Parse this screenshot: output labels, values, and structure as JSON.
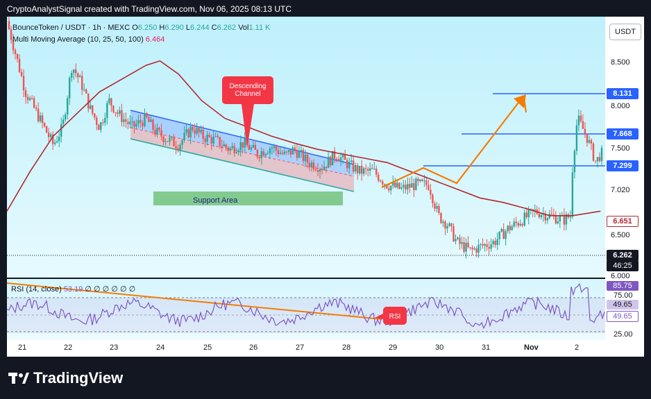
{
  "caption": "CryptoAnalystSignal created with TradingView.com, Nov 06, 2025 08:13 UTC",
  "legend": {
    "symbol": "BounceToken / USDT · 1h · MEXC",
    "open_label": "O",
    "open": "6.250",
    "high_label": "H",
    "high": "6.290",
    "low_label": "L",
    "low": "6.244",
    "close_label": "C",
    "close": "6.262",
    "vol_label": "Vol",
    "vol": "1.11 K",
    "ma_label": "Multi Moving Average (10, 25, 50, 100)",
    "ma_value": "6.464"
  },
  "currency_button": "USDT",
  "annotations": {
    "descending_channel": "Descending Channel",
    "support_area": "Support Area",
    "rsi_tag": "RSI"
  },
  "price_axis": {
    "ticks": [
      "8.500",
      "8.000",
      "7.500",
      "7.020",
      "6.500",
      "6.000"
    ],
    "levels": [
      {
        "value": "8.131",
        "color": "#2962ff"
      },
      {
        "value": "7.668",
        "color": "#2962ff"
      },
      {
        "value": "7.299",
        "color": "#2962ff"
      },
      {
        "value": "6.651",
        "color": "#b2282e"
      },
      {
        "value": "6.262",
        "color": "#131722"
      }
    ],
    "countdown": "46:25"
  },
  "time_axis": [
    "21",
    "22",
    "23",
    "24",
    "25",
    "26",
    "27",
    "28",
    "29",
    "30",
    "31",
    "Nov",
    "2"
  ],
  "rsi": {
    "label": "RSI (14, close)",
    "value": "53.19",
    "extras": "∅ ∅ ∅ ∅ ∅ ∅",
    "ticks": [
      "75.00",
      "25.00"
    ],
    "badges": [
      "85.75",
      "49.65",
      "49.65"
    ]
  },
  "footer": "TradingView",
  "colors": {
    "up": "#26a69a",
    "down": "#ef5350",
    "ma": "#b2282e",
    "level_line": "#2962ff",
    "projection": "#f57c00",
    "rsi_line": "#7e57c2",
    "channel_fill": "#e8b4bc",
    "support_fill": "#66bb6a"
  },
  "chart_data": {
    "type": "candlestick",
    "y_range": [
      5.9,
      8.85
    ],
    "x_labels": [
      "21",
      "22",
      "23",
      "24",
      "25",
      "26",
      "27",
      "28",
      "29",
      "30",
      "31",
      "Nov",
      "2"
    ],
    "close_path": [
      [
        20.8,
        8.8
      ],
      [
        21.0,
        8.4
      ],
      [
        21.2,
        8.0
      ],
      [
        21.5,
        7.7
      ],
      [
        21.8,
        7.4
      ],
      [
        22.0,
        7.6
      ],
      [
        22.2,
        8.3
      ],
      [
        22.4,
        8.1
      ],
      [
        22.6,
        7.8
      ],
      [
        22.8,
        7.6
      ],
      [
        23.0,
        7.9
      ],
      [
        23.2,
        7.75
      ],
      [
        23.5,
        7.6
      ],
      [
        23.8,
        7.7
      ],
      [
        24.0,
        7.55
      ],
      [
        24.3,
        7.45
      ],
      [
        24.5,
        7.4
      ],
      [
        24.8,
        7.6
      ],
      [
        25.0,
        7.5
      ],
      [
        25.3,
        7.45
      ],
      [
        25.6,
        7.35
      ],
      [
        25.9,
        7.42
      ],
      [
        26.2,
        7.3
      ],
      [
        26.5,
        7.38
      ],
      [
        26.8,
        7.28
      ],
      [
        27.0,
        7.35
      ],
      [
        27.3,
        7.2
      ],
      [
        27.6,
        7.15
      ],
      [
        27.9,
        7.3
      ],
      [
        28.1,
        7.2
      ],
      [
        28.4,
        7.1
      ],
      [
        28.7,
        7.1
      ],
      [
        29.0,
        6.95
      ],
      [
        29.3,
        6.9
      ],
      [
        29.6,
        6.95
      ],
      [
        29.9,
        6.95
      ],
      [
        30.1,
        6.6
      ],
      [
        30.3,
        6.5
      ],
      [
        30.5,
        6.3
      ],
      [
        30.8,
        6.2
      ],
      [
        31.0,
        6.25
      ],
      [
        31.3,
        6.3
      ],
      [
        31.6,
        6.45
      ],
      [
        31.9,
        6.55
      ],
      [
        32.2,
        6.65
      ],
      [
        32.5,
        6.6
      ],
      [
        32.8,
        6.55
      ],
      [
        32.95,
        6.6
      ],
      [
        33.0,
        7.2
      ],
      [
        33.1,
        7.7
      ],
      [
        33.3,
        7.5
      ],
      [
        33.5,
        7.2
      ],
      [
        33.6,
        7.3
      ]
    ],
    "moving_average": [
      [
        20.8,
        6.65
      ],
      [
        21.3,
        7.1
      ],
      [
        21.8,
        7.5
      ],
      [
        22.3,
        7.75
      ],
      [
        22.8,
        8.0
      ],
      [
        23.3,
        8.15
      ],
      [
        23.8,
        8.3
      ],
      [
        24.1,
        8.35
      ],
      [
        24.5,
        8.2
      ],
      [
        25.0,
        7.9
      ],
      [
        25.5,
        7.7
      ],
      [
        26.0,
        7.6
      ],
      [
        26.5,
        7.5
      ],
      [
        27.0,
        7.42
      ],
      [
        27.5,
        7.35
      ],
      [
        28.0,
        7.3
      ],
      [
        28.5,
        7.25
      ],
      [
        29.0,
        7.2
      ],
      [
        29.5,
        7.1
      ],
      [
        30.0,
        7.0
      ],
      [
        30.5,
        6.9
      ],
      [
        31.0,
        6.8
      ],
      [
        31.5,
        6.75
      ],
      [
        32.0,
        6.68
      ],
      [
        32.5,
        6.6
      ],
      [
        33.0,
        6.6
      ],
      [
        33.6,
        6.651
      ]
    ],
    "levels": [
      8.131,
      7.668,
      7.299,
      6.651,
      6.262
    ],
    "rsi_range": [
      20,
      90
    ],
    "rsi_bands": [
      75,
      25
    ]
  }
}
